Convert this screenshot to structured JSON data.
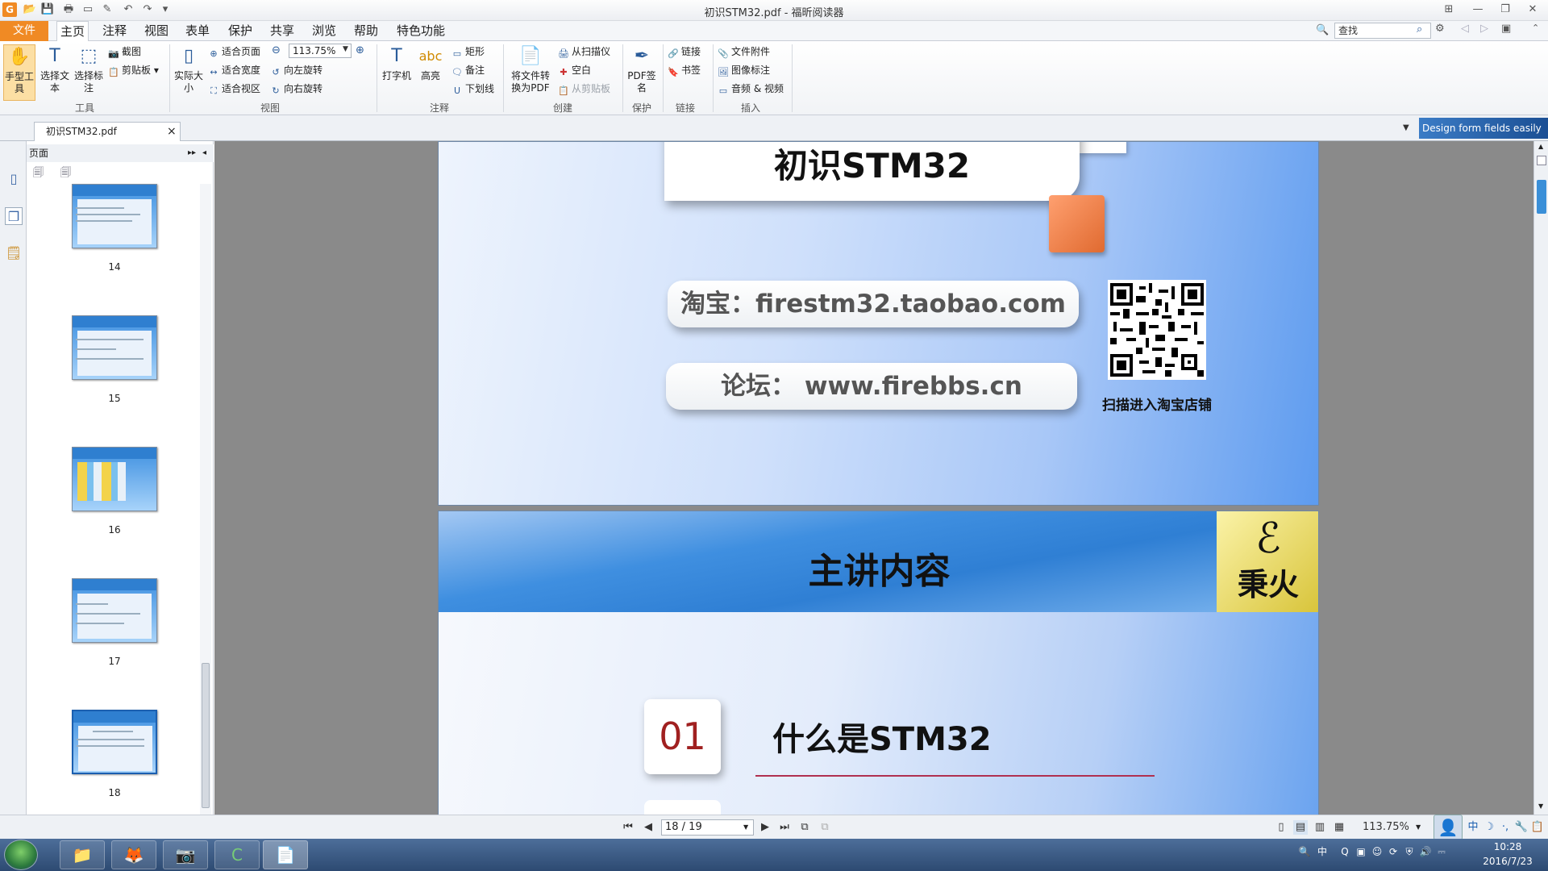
{
  "window": {
    "title": "初识STM32.pdf - 福昕阅读器",
    "app_logo": "G"
  },
  "menu": {
    "file": "文件",
    "items": [
      "主页",
      "注释",
      "视图",
      "表单",
      "保护",
      "共享",
      "浏览",
      "帮助",
      "特色功能"
    ]
  },
  "search": {
    "placeholder": "查找"
  },
  "ribbon": {
    "hand": "手型工具",
    "select_text": "选择文本",
    "select_annot": "选择标注",
    "snapshot": "截图",
    "clipboard": "剪贴板",
    "group_tools": "工具",
    "actual_size": "实际大小",
    "fit_page": "适合页面",
    "fit_width": "适合宽度",
    "fit_visible": "适合视区",
    "zoom": "113.75%",
    "rotate_left": "向左旋转",
    "rotate_right": "向右旋转",
    "group_view": "视图",
    "typewriter": "打字机",
    "highlight": "高亮",
    "highlight_glyph": "abc",
    "rect": "矩形",
    "note": "备注",
    "underline": "下划线",
    "group_annot": "注释",
    "to_pdf": "将文件转换为PDF",
    "from_scanner": "从扫描仪",
    "blank": "空白",
    "from_clipboard": "从剪贴板",
    "group_create": "创建",
    "pdf_sign": "PDF签名",
    "group_protect": "保护",
    "link": "链接",
    "bookmark": "书签",
    "group_link": "链接",
    "file_attach": "文件附件",
    "image_annot": "图像标注",
    "audio_video": "音频 & 视频",
    "group_insert": "插入"
  },
  "tab": {
    "name": "初识STM32.pdf",
    "close": "×",
    "banner": "Design form fields easily"
  },
  "panel": {
    "title": "页面",
    "thumbs": [
      "14",
      "15",
      "16",
      "17",
      "18"
    ]
  },
  "page1": {
    "title": "初识STM32",
    "taobao": "淘宝：firestm32.taobao.com",
    "forum": "论坛： www.firebbs.cn",
    "qr_caption": "扫描进入淘宝店铺"
  },
  "page2": {
    "title": "主讲内容",
    "logo_glyph": "ℰ",
    "logo_text": "秉火",
    "item_num": "01",
    "item_text": "什么是STM32"
  },
  "status": {
    "page": "18 / 19",
    "zoom": "113.75%"
  },
  "clock": {
    "time": "10:28",
    "date": "2016/7/23"
  },
  "tray": {
    "ime": "中"
  }
}
